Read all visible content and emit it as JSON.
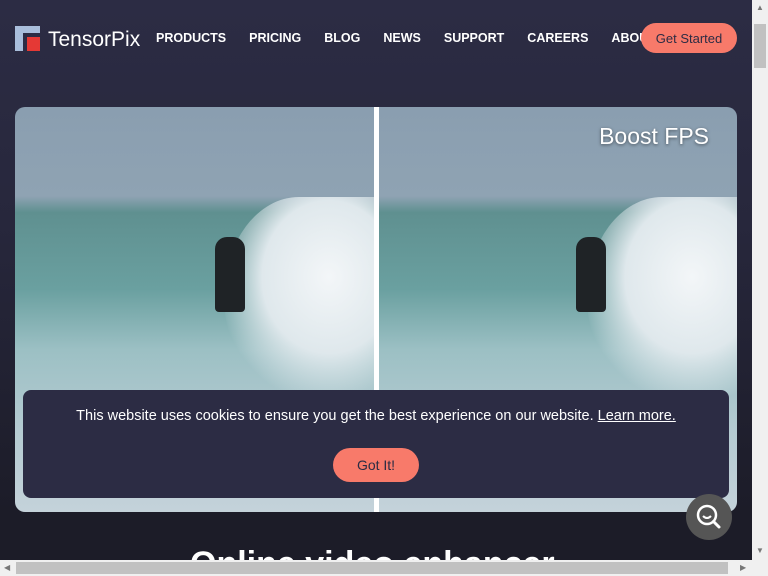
{
  "header": {
    "logo_text": "TensorPix",
    "nav": [
      "PRODUCTS",
      "PRICING",
      "BLOG",
      "NEWS",
      "SUPPORT",
      "CAREERS",
      "ABOUT"
    ],
    "cta_label": "Get Started"
  },
  "hero": {
    "overlay_label": "Boost FPS"
  },
  "cookie_banner": {
    "message": "This website uses cookies to ensure you get the best experience on our website.",
    "link_label": "Learn more.",
    "button_label": "Got It!"
  },
  "section": {
    "heading": "Online video enhancer"
  },
  "colors": {
    "accent": "#f87a6a",
    "background": "#2c2c44",
    "logo_red": "#e53935"
  },
  "icons": {
    "search_fab": "search-icon"
  }
}
